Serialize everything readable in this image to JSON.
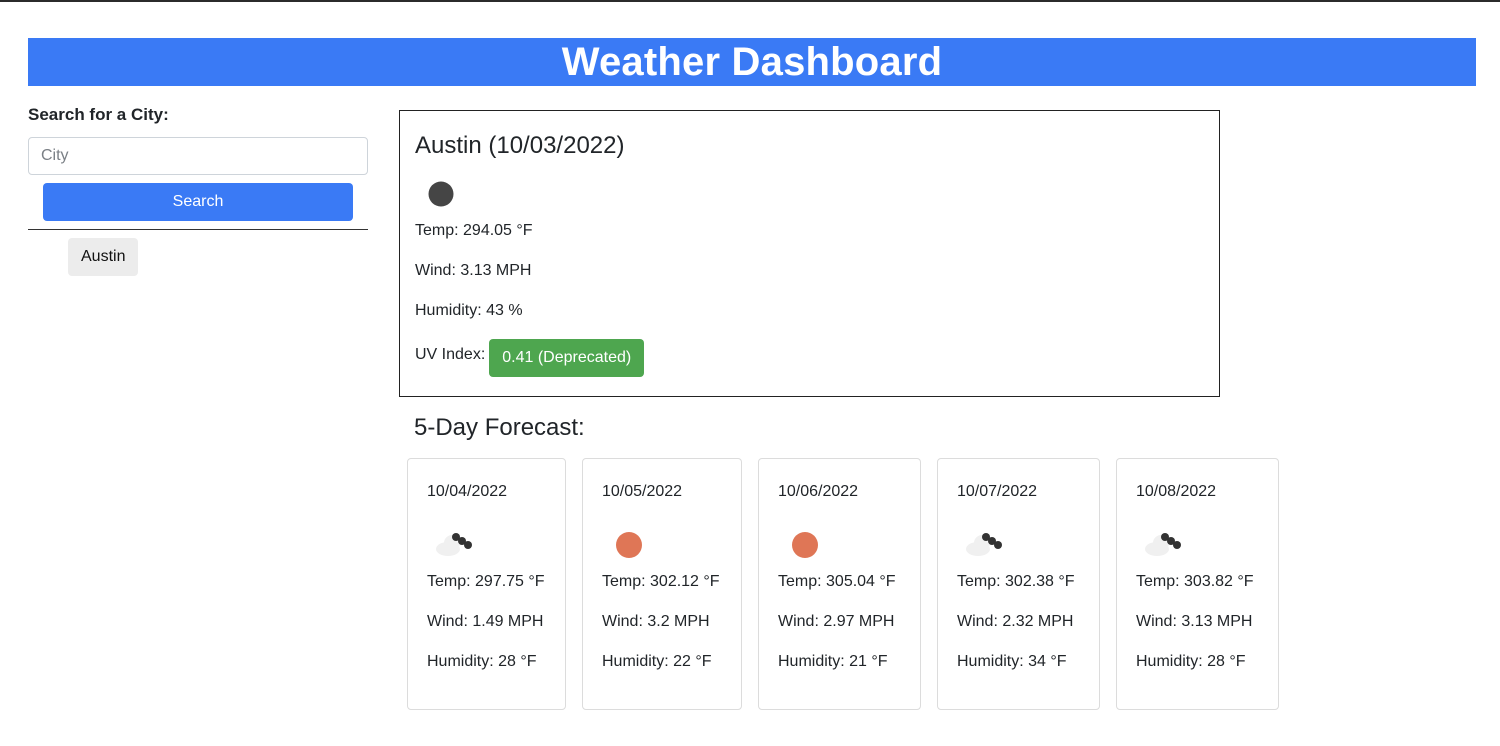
{
  "header": {
    "title": "Weather Dashboard"
  },
  "sidebar": {
    "search_label": "Search for a City:",
    "city_placeholder": "City",
    "city_value": "",
    "search_button": "Search",
    "history": [
      "Austin"
    ]
  },
  "current": {
    "title": "Austin (10/03/2022)",
    "icon": "night-clear-icon",
    "temp": "Temp: 294.05 °F",
    "wind": "Wind: 3.13 MPH",
    "humidity": "Humidity: 43 %",
    "uv_label": "UV Index:",
    "uv_value": "0.41 (Deprecated)",
    "uv_color": "#4ea64f"
  },
  "forecast": {
    "title": "5-Day Forecast:",
    "days": [
      {
        "date": "10/04/2022",
        "icon": "broken-clouds-icon",
        "temp": "Temp: 297.75 °F",
        "wind": "Wind: 1.49 MPH",
        "humidity": "Humidity: 28 °F"
      },
      {
        "date": "10/05/2022",
        "icon": "sun-icon",
        "temp": "Temp: 302.12 °F",
        "wind": "Wind: 3.2 MPH",
        "humidity": "Humidity: 22 °F"
      },
      {
        "date": "10/06/2022",
        "icon": "sun-icon",
        "temp": "Temp: 305.04 °F",
        "wind": "Wind: 2.97 MPH",
        "humidity": "Humidity: 21 °F"
      },
      {
        "date": "10/07/2022",
        "icon": "broken-clouds-icon",
        "temp": "Temp: 302.38 °F",
        "wind": "Wind: 2.32 MPH",
        "humidity": "Humidity: 34 °F"
      },
      {
        "date": "10/08/2022",
        "icon": "broken-clouds-icon",
        "temp": "Temp: 303.82 °F",
        "wind": "Wind: 3.13 MPH",
        "humidity": "Humidity: 28 °F"
      }
    ]
  },
  "colors": {
    "accent": "#3a7af5",
    "uv_good": "#4ea64f",
    "sun": "#df7656",
    "moon": "#454545"
  }
}
